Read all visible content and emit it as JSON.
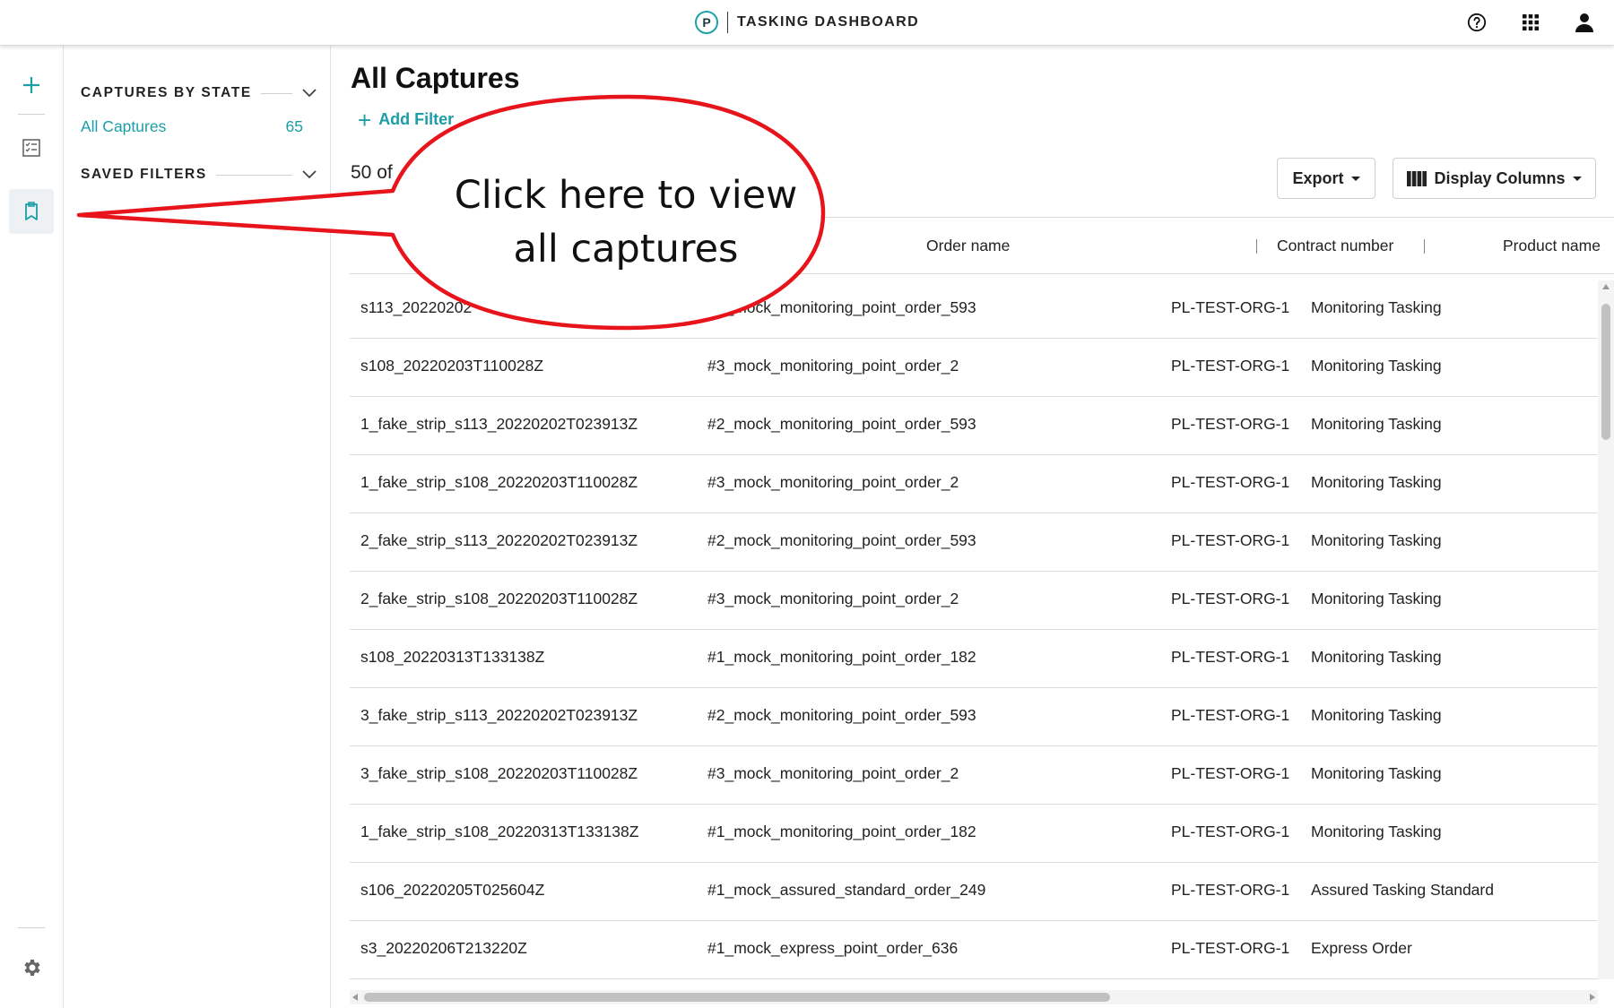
{
  "app": {
    "logo_letter": "P",
    "title": "TASKING DASHBOARD"
  },
  "topbar": {
    "icons": [
      "help-icon",
      "apps-grid-icon",
      "account-icon"
    ]
  },
  "rail": {
    "icons": [
      "add-icon",
      "checklist-icon",
      "captures-icon",
      "settings-icon"
    ]
  },
  "sidebar": {
    "captures_by_state": {
      "title": "CAPTURES BY STATE",
      "items": [
        {
          "label": "All Captures",
          "count": "65"
        }
      ]
    },
    "saved_filters": {
      "title": "SAVED FILTERS"
    }
  },
  "main": {
    "title": "All Captures",
    "add_filter_label": "Add Filter",
    "count_text": "50 of",
    "export_label": "Export",
    "display_columns_label": "Display Columns",
    "columns": [
      "Order name",
      "Contract number",
      "Product name"
    ],
    "rows": [
      [
        "s113_20220202",
        "#2_mock_monitoring_point_order_593",
        "PL-TEST-ORG-1",
        "Monitoring Tasking"
      ],
      [
        "s108_20220203T110028Z",
        "#3_mock_monitoring_point_order_2",
        "PL-TEST-ORG-1",
        "Monitoring Tasking"
      ],
      [
        "1_fake_strip_s113_20220202T023913Z",
        "#2_mock_monitoring_point_order_593",
        "PL-TEST-ORG-1",
        "Monitoring Tasking"
      ],
      [
        "1_fake_strip_s108_20220203T110028Z",
        "#3_mock_monitoring_point_order_2",
        "PL-TEST-ORG-1",
        "Monitoring Tasking"
      ],
      [
        "2_fake_strip_s113_20220202T023913Z",
        "#2_mock_monitoring_point_order_593",
        "PL-TEST-ORG-1",
        "Monitoring Tasking"
      ],
      [
        "2_fake_strip_s108_20220203T110028Z",
        "#3_mock_monitoring_point_order_2",
        "PL-TEST-ORG-1",
        "Monitoring Tasking"
      ],
      [
        "s108_20220313T133138Z",
        "#1_mock_monitoring_point_order_182",
        "PL-TEST-ORG-1",
        "Monitoring Tasking"
      ],
      [
        "3_fake_strip_s113_20220202T023913Z",
        "#2_mock_monitoring_point_order_593",
        "PL-TEST-ORG-1",
        "Monitoring Tasking"
      ],
      [
        "3_fake_strip_s108_20220203T110028Z",
        "#3_mock_monitoring_point_order_2",
        "PL-TEST-ORG-1",
        "Monitoring Tasking"
      ],
      [
        "1_fake_strip_s108_20220313T133138Z",
        "#1_mock_monitoring_point_order_182",
        "PL-TEST-ORG-1",
        "Monitoring Tasking"
      ],
      [
        "s106_20220205T025604Z",
        "#1_mock_assured_standard_order_249",
        "PL-TEST-ORG-1",
        "Assured Tasking Standard"
      ],
      [
        "s3_20220206T213220Z",
        "#1_mock_express_point_order_636",
        "PL-TEST-ORG-1",
        "Express Order"
      ]
    ]
  },
  "callout": {
    "text_line1": "Click here to view",
    "text_line2": "all captures",
    "stroke_color": "#e8141b"
  },
  "colors": {
    "accent": "#1b9ea6",
    "text": "#222222",
    "border": "#d8d8d8"
  }
}
